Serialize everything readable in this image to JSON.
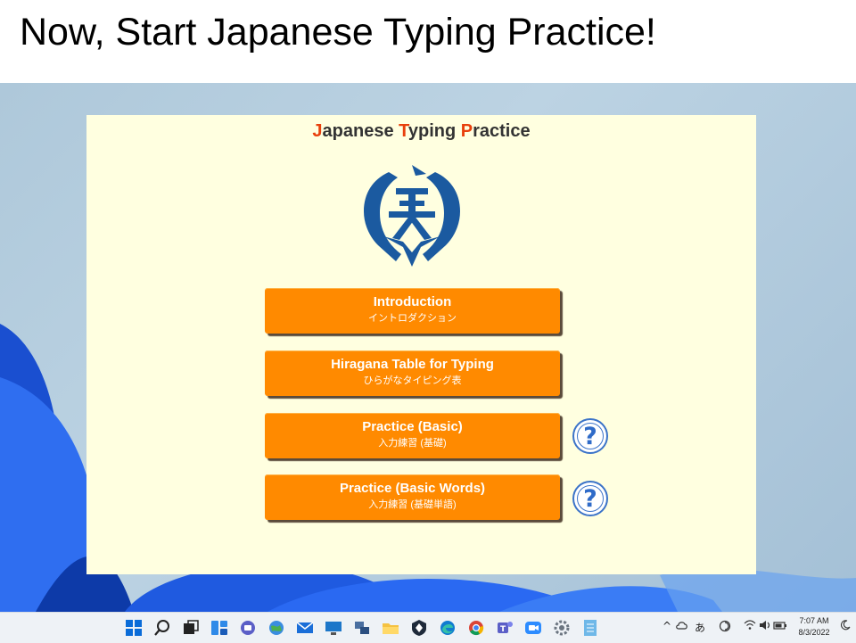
{
  "slide": {
    "title": "Now, Start Japanese Typing Practice!"
  },
  "app": {
    "title_parts": [
      {
        "text": "J",
        "accent": true
      },
      {
        "text": "apanese ",
        "accent": false
      },
      {
        "text": "T",
        "accent": true
      },
      {
        "text": "yping ",
        "accent": false
      },
      {
        "text": "P",
        "accent": true
      },
      {
        "text": "ractice",
        "accent": false
      }
    ],
    "accent_color": "#e8400c",
    "button_color": "#ff8a00",
    "buttons": [
      {
        "en": "Introduction",
        "jp": "イントロダクション"
      },
      {
        "en": "Hiragana Table for Typing",
        "jp": "ひらがなタイピング表"
      },
      {
        "en": "Practice (Basic)",
        "jp": "入力練習 (基礎)"
      },
      {
        "en": "Practice (Basic Words)",
        "jp": "入力練習 (基礎単語)"
      }
    ],
    "help_symbol": "?"
  },
  "taskbar": {
    "icons": [
      "start-icon",
      "search-icon",
      "task-view-icon",
      "widgets-icon",
      "chat-icon",
      "browser-globe-icon",
      "mail-icon",
      "monitor-icon",
      "network-icon",
      "file-explorer-icon",
      "security-icon",
      "edge-icon",
      "chrome-icon",
      "teams-icon",
      "zoom-icon",
      "settings-icon",
      "notepad-icon"
    ],
    "tray": {
      "chevron": "^",
      "ime": "あ"
    },
    "clock": {
      "time": "7:07 AM",
      "date": "8/3/2022"
    }
  }
}
